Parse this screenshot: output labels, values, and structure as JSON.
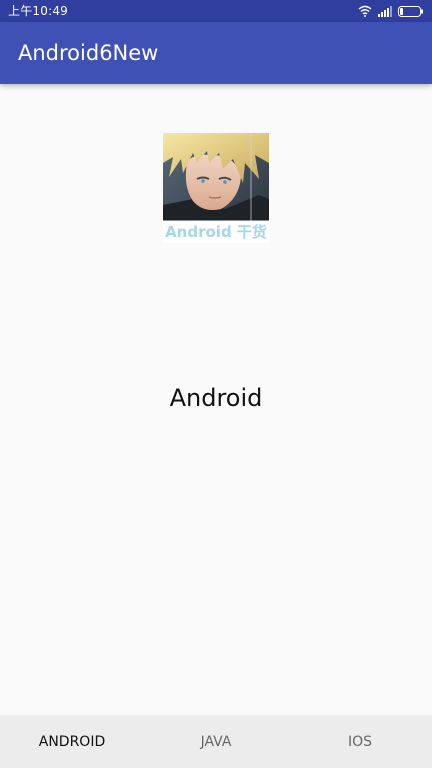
{
  "status_bar": {
    "time": "上午10:49",
    "icons": [
      "wifi-icon",
      "signal-icon",
      "battery-icon"
    ]
  },
  "app_bar": {
    "title": "Android6New",
    "color": "#3f51b5"
  },
  "content": {
    "image_caption": "Android 干货",
    "label": "Android"
  },
  "bottom_nav": {
    "tabs": [
      {
        "label": "ANDROID",
        "active": true
      },
      {
        "label": "JAVA",
        "active": false
      },
      {
        "label": "IOS",
        "active": false
      }
    ]
  },
  "colors": {
    "status_bar": "#303f9f",
    "primary": "#3f51b5",
    "background": "#fafafa",
    "nav_background": "#ececec"
  }
}
